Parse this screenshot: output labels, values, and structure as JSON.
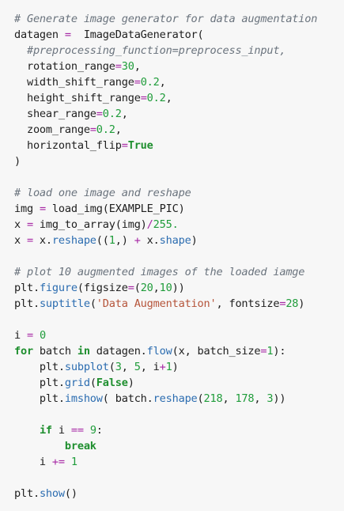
{
  "code": {
    "lines": [
      [
        {
          "t": "cm",
          "v": "# Generate image generator for data augmentation"
        }
      ],
      [
        {
          "t": "pl",
          "v": "datagen "
        },
        {
          "t": "op",
          "v": "="
        },
        {
          "t": "pl",
          "v": "  ImageDataGenerator("
        }
      ],
      [
        {
          "t": "cm",
          "v": "  #preprocessing_function=preprocess_input,"
        }
      ],
      [
        {
          "t": "pl",
          "v": "  rotation_range"
        },
        {
          "t": "op",
          "v": "="
        },
        {
          "t": "num",
          "v": "30"
        },
        {
          "t": "pl",
          "v": ","
        }
      ],
      [
        {
          "t": "pl",
          "v": "  width_shift_range"
        },
        {
          "t": "op",
          "v": "="
        },
        {
          "t": "num",
          "v": "0.2"
        },
        {
          "t": "pl",
          "v": ","
        }
      ],
      [
        {
          "t": "pl",
          "v": "  height_shift_range"
        },
        {
          "t": "op",
          "v": "="
        },
        {
          "t": "num",
          "v": "0.2"
        },
        {
          "t": "pl",
          "v": ","
        }
      ],
      [
        {
          "t": "pl",
          "v": "  shear_range"
        },
        {
          "t": "op",
          "v": "="
        },
        {
          "t": "num",
          "v": "0.2"
        },
        {
          "t": "pl",
          "v": ","
        }
      ],
      [
        {
          "t": "pl",
          "v": "  zoom_range"
        },
        {
          "t": "op",
          "v": "="
        },
        {
          "t": "num",
          "v": "0.2"
        },
        {
          "t": "pl",
          "v": ","
        }
      ],
      [
        {
          "t": "pl",
          "v": "  horizontal_flip"
        },
        {
          "t": "op",
          "v": "="
        },
        {
          "t": "kw",
          "v": "True"
        }
      ],
      [
        {
          "t": "pl",
          "v": ")"
        }
      ],
      [],
      [
        {
          "t": "cm",
          "v": "# load one image and reshape"
        }
      ],
      [
        {
          "t": "pl",
          "v": "img "
        },
        {
          "t": "op",
          "v": "="
        },
        {
          "t": "pl",
          "v": " load_img(EXAMPLE_PIC)"
        }
      ],
      [
        {
          "t": "pl",
          "v": "x "
        },
        {
          "t": "op",
          "v": "="
        },
        {
          "t": "pl",
          "v": " img_to_array(img)"
        },
        {
          "t": "op",
          "v": "/"
        },
        {
          "t": "num",
          "v": "255."
        }
      ],
      [
        {
          "t": "pl",
          "v": "x "
        },
        {
          "t": "op",
          "v": "="
        },
        {
          "t": "pl",
          "v": " x."
        },
        {
          "t": "fn",
          "v": "reshape"
        },
        {
          "t": "pl",
          "v": "(("
        },
        {
          "t": "num",
          "v": "1"
        },
        {
          "t": "pl",
          "v": ",) "
        },
        {
          "t": "op",
          "v": "+"
        },
        {
          "t": "pl",
          "v": " x."
        },
        {
          "t": "fn",
          "v": "shape"
        },
        {
          "t": "pl",
          "v": ")"
        }
      ],
      [],
      [
        {
          "t": "cm",
          "v": "# plot 10 augmented images of the loaded iamge"
        }
      ],
      [
        {
          "t": "pl",
          "v": "plt."
        },
        {
          "t": "fn",
          "v": "figure"
        },
        {
          "t": "pl",
          "v": "(figsize"
        },
        {
          "t": "op",
          "v": "="
        },
        {
          "t": "pl",
          "v": "("
        },
        {
          "t": "num",
          "v": "20"
        },
        {
          "t": "pl",
          "v": ","
        },
        {
          "t": "num",
          "v": "10"
        },
        {
          "t": "pl",
          "v": "))"
        }
      ],
      [
        {
          "t": "pl",
          "v": "plt."
        },
        {
          "t": "fn",
          "v": "suptitle"
        },
        {
          "t": "pl",
          "v": "("
        },
        {
          "t": "str",
          "v": "'Data Augmentation'"
        },
        {
          "t": "pl",
          "v": ", fontsize"
        },
        {
          "t": "op",
          "v": "="
        },
        {
          "t": "num",
          "v": "28"
        },
        {
          "t": "pl",
          "v": ")"
        }
      ],
      [],
      [
        {
          "t": "pl",
          "v": "i "
        },
        {
          "t": "op",
          "v": "="
        },
        {
          "t": "pl",
          "v": " "
        },
        {
          "t": "num",
          "v": "0"
        }
      ],
      [
        {
          "t": "kw",
          "v": "for"
        },
        {
          "t": "pl",
          "v": " batch "
        },
        {
          "t": "kw",
          "v": "in"
        },
        {
          "t": "pl",
          "v": " datagen."
        },
        {
          "t": "fn",
          "v": "flow"
        },
        {
          "t": "pl",
          "v": "(x, batch_size"
        },
        {
          "t": "op",
          "v": "="
        },
        {
          "t": "num",
          "v": "1"
        },
        {
          "t": "pl",
          "v": "):"
        }
      ],
      [
        {
          "t": "pl",
          "v": "    plt."
        },
        {
          "t": "fn",
          "v": "subplot"
        },
        {
          "t": "pl",
          "v": "("
        },
        {
          "t": "num",
          "v": "3"
        },
        {
          "t": "pl",
          "v": ", "
        },
        {
          "t": "num",
          "v": "5"
        },
        {
          "t": "pl",
          "v": ", i"
        },
        {
          "t": "op",
          "v": "+"
        },
        {
          "t": "num",
          "v": "1"
        },
        {
          "t": "pl",
          "v": ")"
        }
      ],
      [
        {
          "t": "pl",
          "v": "    plt."
        },
        {
          "t": "fn",
          "v": "grid"
        },
        {
          "t": "pl",
          "v": "("
        },
        {
          "t": "kw",
          "v": "False"
        },
        {
          "t": "pl",
          "v": ")"
        }
      ],
      [
        {
          "t": "pl",
          "v": "    plt."
        },
        {
          "t": "fn",
          "v": "imshow"
        },
        {
          "t": "pl",
          "v": "( batch."
        },
        {
          "t": "fn",
          "v": "reshape"
        },
        {
          "t": "pl",
          "v": "("
        },
        {
          "t": "num",
          "v": "218"
        },
        {
          "t": "pl",
          "v": ", "
        },
        {
          "t": "num",
          "v": "178"
        },
        {
          "t": "pl",
          "v": ", "
        },
        {
          "t": "num",
          "v": "3"
        },
        {
          "t": "pl",
          "v": "))"
        }
      ],
      [],
      [
        {
          "t": "pl",
          "v": "    "
        },
        {
          "t": "kw",
          "v": "if"
        },
        {
          "t": "pl",
          "v": " i "
        },
        {
          "t": "op",
          "v": "=="
        },
        {
          "t": "pl",
          "v": " "
        },
        {
          "t": "num",
          "v": "9"
        },
        {
          "t": "pl",
          "v": ":"
        }
      ],
      [
        {
          "t": "pl",
          "v": "        "
        },
        {
          "t": "kw",
          "v": "break"
        }
      ],
      [
        {
          "t": "pl",
          "v": "    i "
        },
        {
          "t": "op",
          "v": "+="
        },
        {
          "t": "pl",
          "v": " "
        },
        {
          "t": "num",
          "v": "1"
        }
      ],
      [],
      [
        {
          "t": "pl",
          "v": "plt."
        },
        {
          "t": "fn",
          "v": "show"
        },
        {
          "t": "pl",
          "v": "()"
        }
      ]
    ]
  }
}
